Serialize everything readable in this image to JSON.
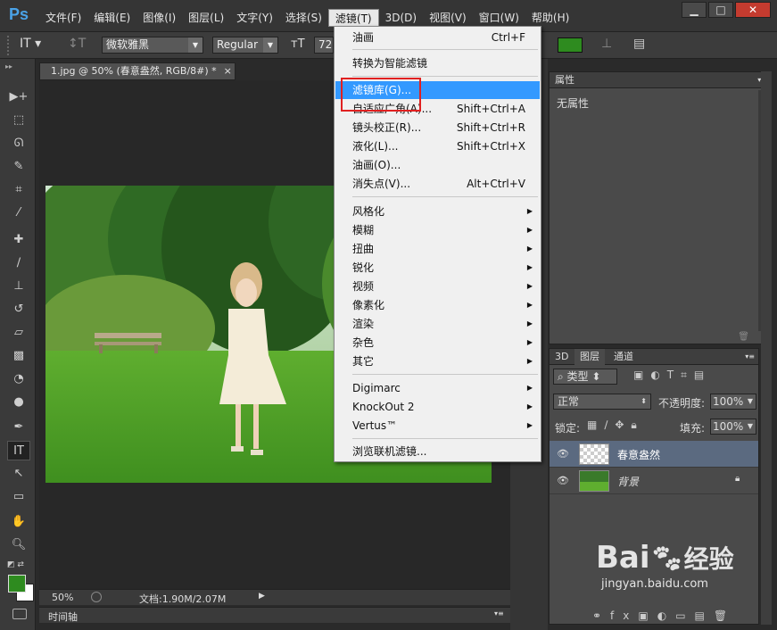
{
  "app": {
    "logo": "Ps"
  },
  "menubar": [
    "文件(F)",
    "编辑(E)",
    "图像(I)",
    "图层(L)",
    "文字(Y)",
    "选择(S)",
    "滤镜(T)",
    "3D(D)",
    "视图(V)",
    "窗口(W)",
    "帮助(H)"
  ],
  "window_controls": {
    "minimize": "▁",
    "maximize": "□",
    "close": "✕"
  },
  "options": {
    "font_family": "微软雅黑",
    "font_style": "Regular",
    "font_size": "72"
  },
  "document": {
    "tab_title": "1.jpg @ 50% (春意盎然, RGB/8#) *",
    "zoom": "50%",
    "doc_info": "文档:1.90M/2.07M",
    "timeline": "时间轴"
  },
  "filter_menu": {
    "items": [
      {
        "label": "油画",
        "shortcut": "Ctrl+F"
      },
      {
        "label": "转换为智能滤镜",
        "shortcut": ""
      },
      {
        "label": "滤镜库(G)...",
        "shortcut": ""
      },
      {
        "label": "自适应广角(A)...",
        "shortcut": "Shift+Ctrl+A"
      },
      {
        "label": "镜头校正(R)...",
        "shortcut": "Shift+Ctrl+R"
      },
      {
        "label": "液化(L)...",
        "shortcut": "Shift+Ctrl+X"
      },
      {
        "label": "油画(O)...",
        "shortcut": ""
      },
      {
        "label": "消失点(V)...",
        "shortcut": "Alt+Ctrl+V"
      },
      {
        "label": "风格化",
        "shortcut": ""
      },
      {
        "label": "模糊",
        "shortcut": ""
      },
      {
        "label": "扭曲",
        "shortcut": ""
      },
      {
        "label": "锐化",
        "shortcut": ""
      },
      {
        "label": "视频",
        "shortcut": ""
      },
      {
        "label": "像素化",
        "shortcut": ""
      },
      {
        "label": "渲染",
        "shortcut": ""
      },
      {
        "label": "杂色",
        "shortcut": ""
      },
      {
        "label": "其它",
        "shortcut": ""
      },
      {
        "label": "Digimarc",
        "shortcut": ""
      },
      {
        "label": "KnockOut 2",
        "shortcut": ""
      },
      {
        "label": "Vertus™",
        "shortcut": ""
      },
      {
        "label": "浏览联机滤镜...",
        "shortcut": ""
      }
    ]
  },
  "properties": {
    "title": "属性",
    "empty": "无属性"
  },
  "layers": {
    "tabs": [
      "3D",
      "图层",
      "通道"
    ],
    "filter": "类型",
    "blend_mode": "正常",
    "opacity_label": "不透明度:",
    "opacity": "100%",
    "lock_label": "锁定:",
    "fill_label": "填充:",
    "fill": "100%",
    "rows": [
      {
        "name": "春意盎然"
      },
      {
        "name": "背景"
      }
    ]
  },
  "watermark": {
    "brand": "Bai",
    "brand2": "经验",
    "url": "jingyan.baidu.com"
  },
  "colors": {
    "accent": "#3399ff",
    "foreground": "#2e8b1f",
    "highlight_box": "#e02020"
  }
}
